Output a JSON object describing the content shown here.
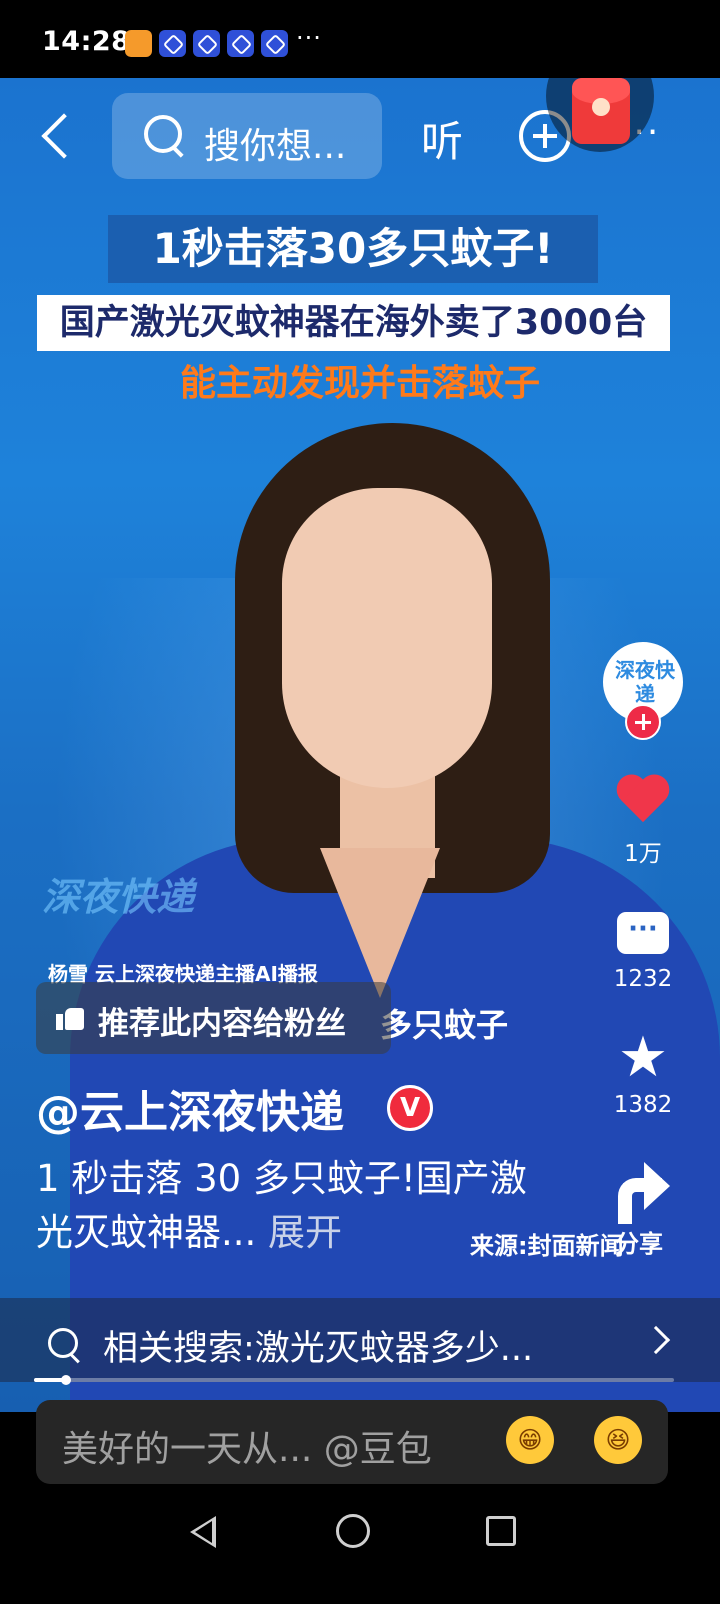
{
  "status_bar": {
    "time": "14:28",
    "more": "···"
  },
  "top_nav": {
    "search_placeholder": "搜你想...",
    "listen_label": "听",
    "more_label": "···"
  },
  "video": {
    "headline_1": "1秒击落30多只蚊子!",
    "headline_2": "国产激光灭蚊神器在海外卖了3000台",
    "headline_3": "能主动发现并击落蚊子",
    "watermark": "深夜快递",
    "anchor_caption": "杨雪 云上深夜快递主播AI播报",
    "burned_subtitle": "多只蚊子",
    "source": "来源:封面新闻"
  },
  "recommend": {
    "label": "推荐此内容给粉丝"
  },
  "actions": {
    "avatar_text": "深夜快递",
    "likes": "1万",
    "comments": "1232",
    "favorites": "1382",
    "share_label": "分享"
  },
  "post": {
    "author": "@云上深夜快递",
    "verified_mark": "V",
    "description": "1 秒击落 30 多只蚊子!国产激光灭蚊神器... ",
    "expand_label": "展开"
  },
  "related_search": {
    "text": "相关搜索:激光灭蚊器多少..."
  },
  "playback": {
    "progress_percent": 5
  },
  "comment_bar": {
    "placeholder": "美好的一天从... @豆包",
    "emoji_1": "😁",
    "emoji_2": "😆"
  },
  "colors": {
    "accent_red": "#f0364a",
    "headline_orange": "#ff7a1a",
    "video_blue": "#1e82da"
  }
}
